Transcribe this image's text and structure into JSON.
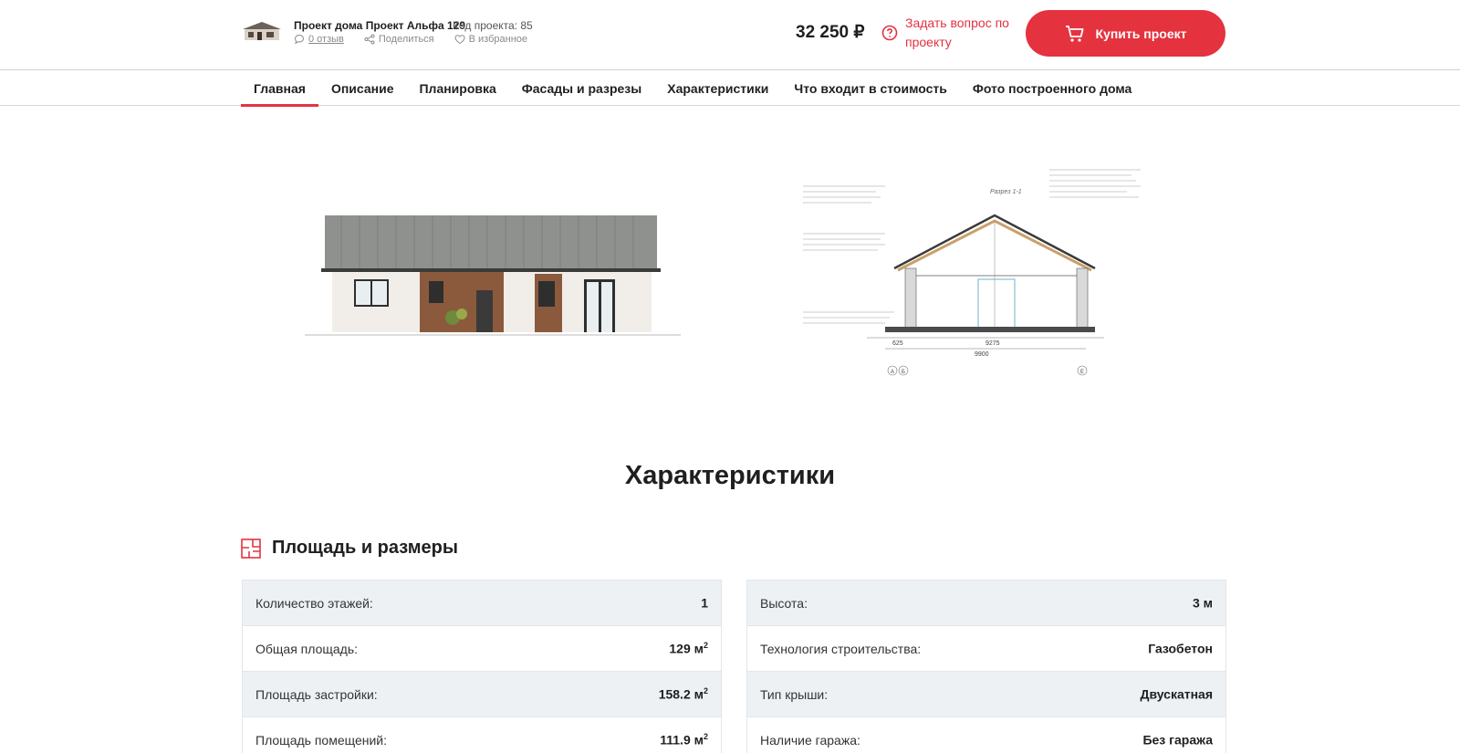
{
  "header": {
    "project_title": "Проект дома Проект Альфа 129",
    "project_code": "Код проекта: 85",
    "reviews": "0 отзыв",
    "share": "Поделиться",
    "favorite": "В избранное",
    "price": "32 250 ₽",
    "ask_question": "Задать вопрос по проекту",
    "buy_label": "Купить проект"
  },
  "nav": {
    "items": [
      {
        "label": "Главная",
        "active": true
      },
      {
        "label": "Описание"
      },
      {
        "label": "Планировка"
      },
      {
        "label": "Фасады и разрезы"
      },
      {
        "label": "Характеристики"
      },
      {
        "label": "Что входит в стоимость"
      },
      {
        "label": "Фото построенного дома"
      }
    ]
  },
  "drawing": {
    "section_title": "Разрез 1-1",
    "dim_1": "625",
    "dim_2": "9275",
    "dim_3": "9900",
    "axis_a": "А",
    "axis_b": "Б",
    "axis_e": "Е"
  },
  "characteristics": {
    "heading": "Характеристики",
    "area_heading": "Площадь и размеры",
    "left_rows": [
      {
        "label": "Количество этажей:",
        "value": "1",
        "unit": ""
      },
      {
        "label": "Общая площадь:",
        "value": "129 м",
        "unit": "2"
      },
      {
        "label": "Площадь застройки:",
        "value": "158.2 м",
        "unit": "2"
      },
      {
        "label": "Площадь помещений:",
        "value": "111.9 м",
        "unit": "2"
      }
    ],
    "right_rows": [
      {
        "label": "Высота:",
        "value": "3 м",
        "unit": ""
      },
      {
        "label": "Технология строительства:",
        "value": "Газобетон",
        "unit": ""
      },
      {
        "label": "Тип крыши:",
        "value": "Двускатная",
        "unit": ""
      },
      {
        "label": "Наличие гаража:",
        "value": "Без гаража",
        "unit": ""
      }
    ]
  },
  "colors": {
    "accent": "#e5323f",
    "row_shade": "#eef1f4"
  }
}
